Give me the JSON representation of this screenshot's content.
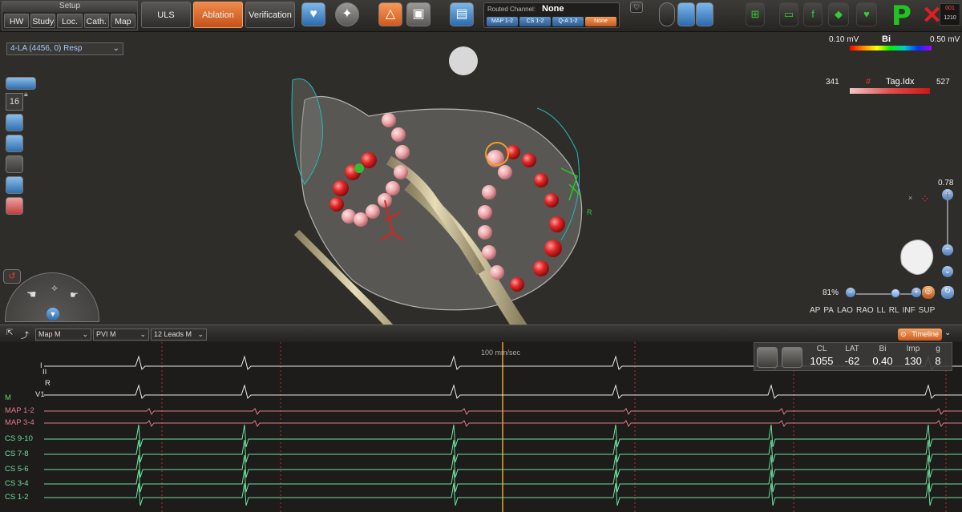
{
  "topbar": {
    "setup_title": "Setup",
    "setup_buttons": [
      "HW",
      "Study",
      "Loc.",
      "Cath.",
      "Map"
    ],
    "mode_buttons": {
      "uls": "ULS",
      "ablation": "Ablation",
      "verification": "Verification"
    },
    "routed_channel": {
      "label": "Routed Channel:",
      "value": "None",
      "options": [
        "MAP 1-2",
        "CS 1-2",
        "Q-A 1-2",
        "None"
      ],
      "selected": "None"
    },
    "status_letter": "P",
    "counter_top": "001",
    "counter_bottom": "1210"
  },
  "map": {
    "map_select": "4-LA (4456, 0) Resp",
    "bi_scale": {
      "min": "0.10 mV",
      "title": "Bi",
      "max": "0.50 mV"
    },
    "tag_scale": {
      "min": "341",
      "title": "Tag.Idx",
      "max": "527"
    },
    "point_count": "16",
    "zoom_percent": "81%",
    "zoom_slider_level": 0.65,
    "vertical_value": "0.78",
    "view_buttons": [
      "AP",
      "PA",
      "LAO",
      "RAO",
      "LL",
      "RL",
      "INF",
      "SUP"
    ],
    "orientation_marker": "R"
  },
  "egm": {
    "selects": [
      "Map M",
      "PVI M",
      "12 Leads M"
    ],
    "timeline_label": "Timeline",
    "speed": "100 mm/sec",
    "channels": [
      {
        "name": "I",
        "color": "#e8e8e8"
      },
      {
        "name": "II",
        "color": "#e8e8e8"
      },
      {
        "name": "R",
        "color": "#e8e8e8"
      },
      {
        "name": "V1",
        "color": "#e8e8e8"
      },
      {
        "name": "M",
        "color": "#5fd36f"
      },
      {
        "name": "MAP 1-2",
        "color": "#e07a8a"
      },
      {
        "name": "MAP 3-4",
        "color": "#e07a8a"
      },
      {
        "name": "CS 9-10",
        "color": "#6fe0a0"
      },
      {
        "name": "CS 7-8",
        "color": "#6fe0a0"
      },
      {
        "name": "CS 5-6",
        "color": "#6fe0a0"
      },
      {
        "name": "CS 3-4",
        "color": "#6fe0a0"
      },
      {
        "name": "CS 1-2",
        "color": "#6fe0a0"
      }
    ],
    "readout": [
      {
        "label": "CL",
        "value": "1055"
      },
      {
        "label": "LAT",
        "value": "-62"
      },
      {
        "label": "Bi",
        "value": "0.40"
      },
      {
        "label": "Imp",
        "value": "130"
      },
      {
        "label": "g",
        "value": "8"
      }
    ]
  },
  "colors": {
    "accent": "#e0621f",
    "ecg": "#e8e8e8",
    "map_channel": "#e07a8a",
    "cs_channel": "#6fe0a0",
    "cursor": "#f0a020",
    "status_ok": "#21c421",
    "status_err": "#e02020"
  }
}
